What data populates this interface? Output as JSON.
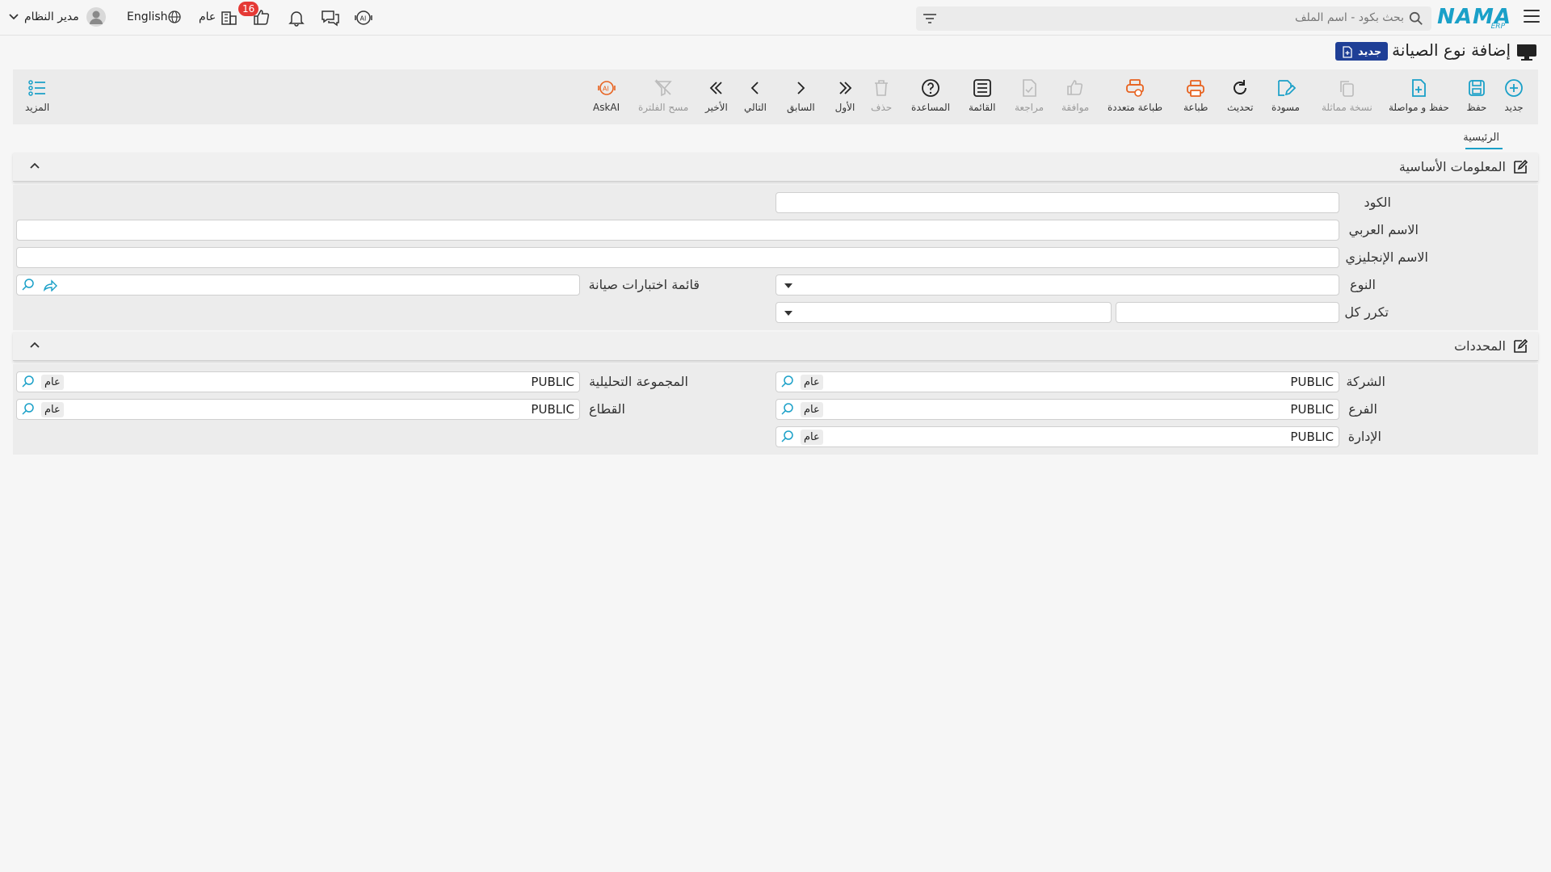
{
  "topbar": {
    "search_placeholder": "بحث بكود - اسم الملف",
    "logo_text": "NAMA",
    "logo_sub": "ERP",
    "user_name": "مدير النظام",
    "language": "English",
    "scope_label": "عام",
    "notification_count": "16"
  },
  "page": {
    "title": "إضافة نوع الصيانة",
    "status_badge": "جديد"
  },
  "toolbar": {
    "new": "جديد",
    "save": "حفظ",
    "save_continue": "حفظ و مواصلة",
    "duplicate": "نسخة مماثلة",
    "draft": "مسودة",
    "refresh": "تحديث",
    "print": "طباعة",
    "multi_print": "طباعة متعددة",
    "approve": "موافقة",
    "review": "مراجعة",
    "list": "القائمة",
    "help": "المساعدة",
    "delete": "حذف",
    "first": "الأول",
    "previous": "السابق",
    "next": "التالي",
    "last": "الأخير",
    "clear_filter": "مسح الفلترة",
    "askai": "AskAI",
    "more": "المزيد"
  },
  "tabs": {
    "main": "الرئيسية"
  },
  "basic_info": {
    "title": "المعلومات الأساسية",
    "code_label": "الكود",
    "code_value": "",
    "arabic_name_label": "الاسم العربي",
    "arabic_name_value": "",
    "english_name_label": "الاسم الإنجليزي",
    "english_name_value": "",
    "type_label": "النوع",
    "type_value": "",
    "checklist_label": "قائمة اختبارات صيانة",
    "checklist_value": "",
    "repeat_label": "تكرر كل",
    "repeat_value": "",
    "repeat_unit": ""
  },
  "determinants": {
    "title": "المحددات",
    "company_label": "الشركة",
    "company_value": "PUBLIC",
    "company_chip": "عام",
    "branch_label": "الفرع",
    "branch_value": "PUBLIC",
    "branch_chip": "عام",
    "department_label": "الإدارة",
    "department_value": "PUBLIC",
    "department_chip": "عام",
    "analysis_group_label": "المجموعة التحليلية",
    "analysis_group_value": "PUBLIC",
    "analysis_group_chip": "عام",
    "sector_label": "القطاع",
    "sector_value": "PUBLIC",
    "sector_chip": "عام"
  },
  "colors": {
    "accent": "#1aa0c8",
    "badge_bg": "#1f3f96",
    "print_orange": "#e8621f",
    "notification_red": "#e53935"
  }
}
